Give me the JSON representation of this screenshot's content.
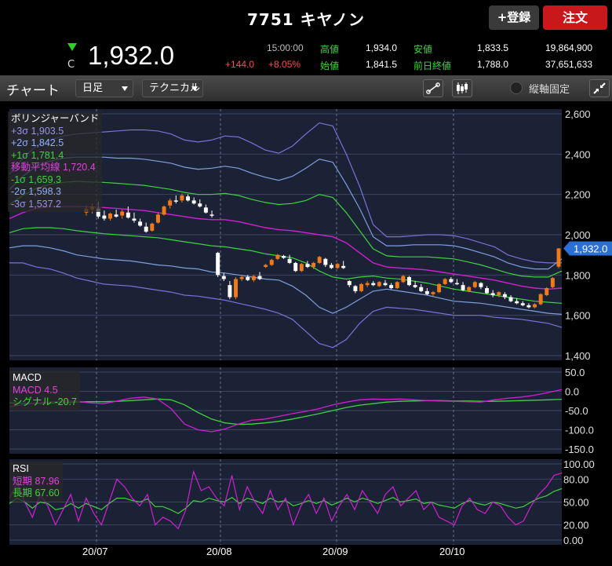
{
  "header": {
    "title": "7751 キヤノン",
    "register_label": "+登録",
    "order_label": "注文"
  },
  "quote": {
    "close_marker": "C",
    "price": "1,932.0",
    "time": "15:00:00",
    "change": "+144.0",
    "change_pct": "+8.05%",
    "high_label": "高値",
    "high": "1,934.0",
    "open_label": "始値",
    "open": "1,841.5",
    "low_label": "安値",
    "low": "1,833.5",
    "prev_close_label": "前日終値",
    "prev_close": "1,788.0",
    "volume": "19,864,900",
    "turnover": "37,651,633"
  },
  "toolbar": {
    "title": "チャート",
    "period": "日足",
    "technical": "テクニカル",
    "fix_axis_label": "縦軸固定"
  },
  "legends": {
    "bollinger": {
      "title": "ボリンジャーバンド",
      "p3": "+3σ 1,903.5",
      "p2": "+2σ 1,842.5",
      "p1": "+1σ 1,781.4",
      "ma": "移動平均線 1,720.4",
      "m1": "-1σ 1,659.3",
      "m2": "-2σ 1,598.3",
      "m3": "-3σ 1,537.2"
    },
    "macd": {
      "title": "MACD",
      "macd": "MACD 4.5",
      "signal": "シグナル -20.7"
    },
    "rsi": {
      "title": "RSI",
      "short": "短期 87.96",
      "long": "長期 67.60"
    }
  },
  "colors": {
    "up": "#f07a1a",
    "down": "#ffffff",
    "sigma3": "#7a72d8",
    "sigma2": "#7f9fe0",
    "sigma1": "#3fd23f",
    "ma": "#d020d0",
    "macd": "#d020d0",
    "signal": "#3fd23f"
  },
  "chart_data": [
    {
      "type": "candlestick",
      "title": "ボリンジャーバンド",
      "y_ticks": [
        "2,600",
        "2,400",
        "2,200",
        "2,000",
        "1,800",
        "1,600",
        "1,400"
      ],
      "ylim": [
        1400,
        2600
      ],
      "x_ticks": [
        "20/07",
        "20/08",
        "20/09",
        "20/10"
      ],
      "last_price_tag": "1,932.0",
      "candles": [
        [
          2110,
          2145,
          2095,
          2130
        ],
        [
          2125,
          2155,
          2105,
          2140
        ],
        [
          2130,
          2165,
          2080,
          2090
        ],
        [
          2095,
          2120,
          2070,
          2080
        ],
        [
          2080,
          2110,
          2070,
          2105
        ],
        [
          2100,
          2125,
          2085,
          2090
        ],
        [
          2095,
          2125,
          2080,
          2115
        ],
        [
          2110,
          2140,
          2080,
          2085
        ],
        [
          2080,
          2110,
          2060,
          2070
        ],
        [
          2065,
          2080,
          2040,
          2045
        ],
        [
          2040,
          2060,
          2010,
          2015
        ],
        [
          2020,
          2060,
          2015,
          2055
        ],
        [
          2060,
          2110,
          2055,
          2100
        ],
        [
          2100,
          2145,
          2095,
          2140
        ],
        [
          2145,
          2180,
          2130,
          2170
        ],
        [
          2170,
          2195,
          2155,
          2165
        ],
        [
          2170,
          2205,
          2160,
          2195
        ],
        [
          2190,
          2200,
          2165,
          2170
        ],
        [
          2170,
          2185,
          2150,
          2155
        ],
        [
          2155,
          2175,
          2135,
          2140
        ],
        [
          2135,
          2150,
          2105,
          2110
        ],
        [
          2100,
          2120,
          2085,
          2095
        ],
        [
          1910,
          1915,
          1790,
          1800
        ],
        [
          1795,
          1810,
          1770,
          1780
        ],
        [
          1750,
          1770,
          1680,
          1690
        ],
        [
          1690,
          1790,
          1680,
          1780
        ],
        [
          1780,
          1800,
          1770,
          1790
        ],
        [
          1790,
          1800,
          1770,
          1775
        ],
        [
          1775,
          1800,
          1765,
          1795
        ],
        [
          1795,
          1815,
          1775,
          1780
        ],
        [
          1840,
          1855,
          1835,
          1850
        ],
        [
          1850,
          1880,
          1845,
          1875
        ],
        [
          1880,
          1905,
          1875,
          1900
        ],
        [
          1895,
          1900,
          1880,
          1885
        ],
        [
          1880,
          1900,
          1855,
          1860
        ],
        [
          1860,
          1865,
          1815,
          1820
        ],
        [
          1820,
          1860,
          1815,
          1855
        ],
        [
          1855,
          1870,
          1835,
          1840
        ],
        [
          1840,
          1865,
          1830,
          1860
        ],
        [
          1860,
          1895,
          1855,
          1890
        ],
        [
          1880,
          1885,
          1840,
          1850
        ],
        [
          1850,
          1860,
          1830,
          1835
        ],
        [
          1835,
          1860,
          1830,
          1855
        ],
        [
          1845,
          1870,
          1830,
          1835
        ],
        [
          1770,
          1775,
          1740,
          1750
        ],
        [
          1745,
          1750,
          1710,
          1720
        ],
        [
          1720,
          1760,
          1715,
          1755
        ],
        [
          1750,
          1770,
          1740,
          1760
        ],
        [
          1760,
          1770,
          1745,
          1750
        ],
        [
          1745,
          1770,
          1740,
          1765
        ],
        [
          1760,
          1775,
          1745,
          1750
        ],
        [
          1750,
          1760,
          1730,
          1735
        ],
        [
          1735,
          1770,
          1730,
          1765
        ],
        [
          1765,
          1800,
          1760,
          1795
        ],
        [
          1790,
          1795,
          1745,
          1750
        ],
        [
          1750,
          1770,
          1735,
          1740
        ],
        [
          1740,
          1755,
          1715,
          1720
        ],
        [
          1720,
          1735,
          1700,
          1705
        ],
        [
          1705,
          1720,
          1695,
          1715
        ],
        [
          1715,
          1760,
          1710,
          1755
        ],
        [
          1755,
          1785,
          1750,
          1780
        ],
        [
          1780,
          1790,
          1760,
          1765
        ],
        [
          1760,
          1780,
          1750,
          1755
        ],
        [
          1750,
          1765,
          1720,
          1725
        ],
        [
          1720,
          1745,
          1715,
          1740
        ],
        [
          1740,
          1770,
          1735,
          1765
        ],
        [
          1760,
          1765,
          1730,
          1740
        ],
        [
          1735,
          1745,
          1705,
          1710
        ],
        [
          1710,
          1725,
          1690,
          1700
        ],
        [
          1700,
          1720,
          1690,
          1715
        ],
        [
          1705,
          1715,
          1680,
          1690
        ],
        [
          1690,
          1700,
          1665,
          1670
        ],
        [
          1670,
          1685,
          1655,
          1660
        ],
        [
          1660,
          1670,
          1645,
          1650
        ],
        [
          1650,
          1660,
          1635,
          1640
        ],
        [
          1640,
          1660,
          1635,
          1655
        ],
        [
          1655,
          1710,
          1650,
          1705
        ],
        [
          1700,
          1740,
          1695,
          1735
        ],
        [
          1740,
          1790,
          1735,
          1785
        ],
        [
          1841.5,
          1934,
          1833.5,
          1932
        ]
      ],
      "bands": {
        "p3": [
          2300,
          2380,
          2440,
          2470,
          2490,
          2500,
          2505,
          2510,
          2515,
          2520,
          2520,
          2515,
          2500,
          2470,
          2460,
          2470,
          2490,
          2485,
          2455,
          2420,
          2405,
          2440,
          2500,
          2555,
          2540,
          2400,
          2240,
          2050,
          1990,
          1990,
          1995,
          2000,
          2000,
          1995,
          1980,
          1960,
          1940,
          1900,
          1880,
          1865,
          1860,
          1860
        ],
        "p2": [
          2225,
          2290,
          2340,
          2365,
          2380,
          2385,
          2385,
          2385,
          2380,
          2380,
          2375,
          2365,
          2355,
          2335,
          2325,
          2330,
          2340,
          2330,
          2305,
          2285,
          2270,
          2290,
          2330,
          2375,
          2360,
          2250,
          2130,
          1990,
          1945,
          1945,
          1950,
          1950,
          1950,
          1945,
          1930,
          1910,
          1890,
          1860,
          1840,
          1830,
          1830,
          1880
        ],
        "p1": [
          2150,
          2195,
          2230,
          2250,
          2260,
          2265,
          2262,
          2260,
          2255,
          2250,
          2245,
          2235,
          2225,
          2210,
          2200,
          2200,
          2205,
          2195,
          2175,
          2160,
          2150,
          2155,
          2170,
          2200,
          2185,
          2110,
          2020,
          1930,
          1895,
          1890,
          1890,
          1890,
          1885,
          1880,
          1865,
          1850,
          1830,
          1810,
          1795,
          1790,
          1790,
          1820
        ],
        "ma": [
          2080,
          2110,
          2130,
          2140,
          2140,
          2140,
          2138,
          2135,
          2130,
          2125,
          2120,
          2110,
          2100,
          2090,
          2080,
          2075,
          2075,
          2065,
          2050,
          2035,
          2025,
          2020,
          2010,
          2000,
          1990,
          1960,
          1910,
          1860,
          1840,
          1835,
          1830,
          1825,
          1815,
          1805,
          1795,
          1785,
          1775,
          1760,
          1745,
          1735,
          1730,
          1735
        ],
        "m1": [
          2010,
          2030,
          2035,
          2035,
          2030,
          2020,
          2012,
          2005,
          2000,
          1995,
          1990,
          1985,
          1975,
          1965,
          1955,
          1945,
          1940,
          1930,
          1920,
          1905,
          1895,
          1885,
          1860,
          1820,
          1790,
          1780,
          1790,
          1795,
          1785,
          1780,
          1770,
          1760,
          1745,
          1730,
          1720,
          1710,
          1700,
          1690,
          1680,
          1670,
          1665,
          1660
        ],
        "m2": [
          1935,
          1945,
          1945,
          1935,
          1920,
          1900,
          1890,
          1880,
          1875,
          1870,
          1860,
          1850,
          1845,
          1835,
          1830,
          1815,
          1810,
          1800,
          1790,
          1780,
          1775,
          1745,
          1700,
          1640,
          1610,
          1640,
          1680,
          1720,
          1730,
          1720,
          1710,
          1700,
          1685,
          1670,
          1665,
          1660,
          1650,
          1640,
          1630,
          1620,
          1610,
          1605
        ],
        "m3": [
          1860,
          1860,
          1840,
          1830,
          1810,
          1785,
          1770,
          1755,
          1750,
          1745,
          1735,
          1725,
          1715,
          1700,
          1695,
          1685,
          1675,
          1660,
          1645,
          1630,
          1610,
          1580,
          1520,
          1460,
          1440,
          1480,
          1560,
          1620,
          1640,
          1635,
          1630,
          1620,
          1610,
          1600,
          1600,
          1600,
          1590,
          1585,
          1580,
          1570,
          1560,
          1540
        ]
      }
    },
    {
      "type": "line",
      "title": "MACD",
      "y_ticks": [
        "50.0",
        "0.0",
        "-50.0",
        "-100.0",
        "-150.0"
      ],
      "ylim": [
        -150,
        50
      ],
      "series": [
        {
          "name": "MACD",
          "values": [
            -40,
            -35,
            -30,
            -28,
            -25,
            -26,
            -30,
            -32,
            -25,
            -18,
            -15,
            -20,
            -45,
            -85,
            -100,
            -105,
            -98,
            -85,
            -75,
            -72,
            -65,
            -58,
            -52,
            -45,
            -35,
            -28,
            -22,
            -20,
            -21,
            -20,
            -22,
            -24,
            -25,
            -26,
            -27,
            -28,
            -22,
            -18,
            -15,
            -10,
            -3,
            4.5
          ]
        },
        {
          "name": "シグナル",
          "values": [
            -30,
            -31,
            -32,
            -31,
            -30,
            -28,
            -27,
            -27,
            -26,
            -24,
            -22,
            -20,
            -22,
            -35,
            -55,
            -72,
            -82,
            -86,
            -85,
            -82,
            -78,
            -72,
            -65,
            -58,
            -50,
            -42,
            -36,
            -32,
            -28,
            -26,
            -25,
            -24,
            -24,
            -25,
            -25,
            -26,
            -26,
            -25,
            -24,
            -23,
            -22,
            -20.7
          ]
        }
      ]
    },
    {
      "type": "line",
      "title": "RSI",
      "y_ticks": [
        "100.00",
        "80.00",
        "50.00",
        "20.00",
        "0.00"
      ],
      "ylim": [
        0,
        100
      ],
      "series": [
        {
          "name": "短期",
          "values": [
            55,
            75,
            50,
            30,
            60,
            45,
            20,
            40,
            60,
            25,
            55,
            35,
            20,
            50,
            80,
            70,
            55,
            45,
            60,
            20,
            30,
            25,
            15,
            40,
            90,
            65,
            70,
            55,
            45,
            85,
            40,
            70,
            50,
            35,
            65,
            40,
            55,
            20,
            45,
            60,
            35,
            55,
            25,
            45,
            60,
            40,
            65,
            50,
            35,
            60,
            70,
            45,
            55,
            65,
            40,
            50,
            30,
            25,
            20,
            45,
            55,
            40,
            35,
            50,
            45,
            30,
            20,
            25,
            45,
            60,
            70,
            85,
            88
          ]
        },
        {
          "name": "長期",
          "values": [
            48,
            55,
            50,
            42,
            50,
            48,
            40,
            42,
            48,
            42,
            48,
            44,
            40,
            48,
            55,
            55,
            52,
            50,
            54,
            44,
            44,
            40,
            35,
            42,
            52,
            50,
            55,
            52,
            50,
            56,
            48,
            55,
            52,
            48,
            55,
            50,
            52,
            45,
            48,
            52,
            48,
            52,
            46,
            50,
            55,
            50,
            55,
            52,
            48,
            52,
            56,
            50,
            52,
            54,
            48,
            50,
            46,
            44,
            42,
            48,
            52,
            48,
            46,
            50,
            48,
            45,
            42,
            44,
            50,
            55,
            58,
            64,
            67.6
          ]
        }
      ]
    }
  ]
}
